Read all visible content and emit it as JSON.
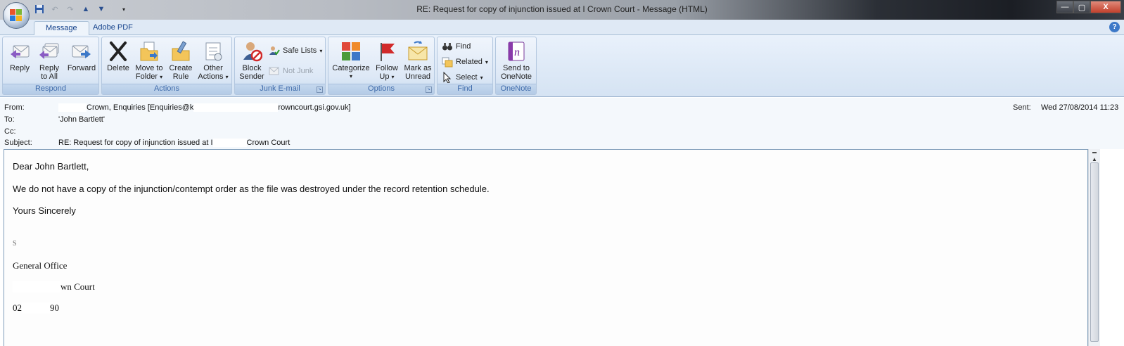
{
  "window": {
    "title": "RE: Request for copy of injunction issued at I          Crown Court - Message (HTML)",
    "minimize": "—",
    "maximize": "▢",
    "close": "X"
  },
  "quick_access": [
    "save-icon",
    "undo-icon",
    "redo-icon",
    "previous-item-icon",
    "next-item-icon",
    "customize-icon"
  ],
  "tabs": [
    {
      "label": "Message",
      "active": true
    },
    {
      "label": "Adobe PDF",
      "active": false
    }
  ],
  "help": "?",
  "ribbon": {
    "respond": {
      "label": "Respond",
      "reply": "Reply",
      "reply_all_1": "Reply",
      "reply_all_2": "to All",
      "forward": "Forward"
    },
    "actions": {
      "label": "Actions",
      "delete": "Delete",
      "move_1": "Move to",
      "move_2": "Folder",
      "rule_1": "Create",
      "rule_2": "Rule",
      "other_1": "Other",
      "other_2": "Actions"
    },
    "junk": {
      "label": "Junk E-mail",
      "block_1": "Block",
      "block_2": "Sender",
      "safe_lists": "Safe Lists",
      "not_junk": "Not Junk"
    },
    "options": {
      "label": "Options",
      "categorize": "Categorize",
      "follow_1": "Follow",
      "follow_2": "Up",
      "mark_1": "Mark as",
      "mark_2": "Unread"
    },
    "find": {
      "label": "Find",
      "find": "Find",
      "related": "Related",
      "select": "Select"
    },
    "onenote": {
      "label": "OneNote",
      "send_1": "Send to",
      "send_2": "OneNote"
    }
  },
  "header": {
    "from_label": "From:",
    "from_value_a": "Crown, Enquiries [Enquiries@k",
    "from_value_b": "rowncourt.gsi.gov.uk]",
    "to_label": "To:",
    "to_value": "'John Bartlett'",
    "cc_label": "Cc:",
    "cc_value": "",
    "subject_label": "Subject:",
    "subject_value_a": "RE: Request for copy of injunction issued at I",
    "subject_value_b": "Crown Court",
    "sent_label": "Sent:",
    "sent_value": "Wed 27/08/2014 11:23"
  },
  "message": {
    "greeting": "Dear John Bartlett,",
    "body": "We do not have a copy of the injunction/contempt order as the file was destroyed under the record retention schedule.",
    "closing": "Yours Sincerely",
    "sig_name": "S",
    "sig_office": "General Office",
    "sig_court": "wn Court",
    "sig_phone_a": "02",
    "sig_phone_b": "90"
  },
  "colors": {
    "ribbon_label": "#3e6aaa",
    "tab_text": "#15428b",
    "accent": "#3c78c8"
  }
}
